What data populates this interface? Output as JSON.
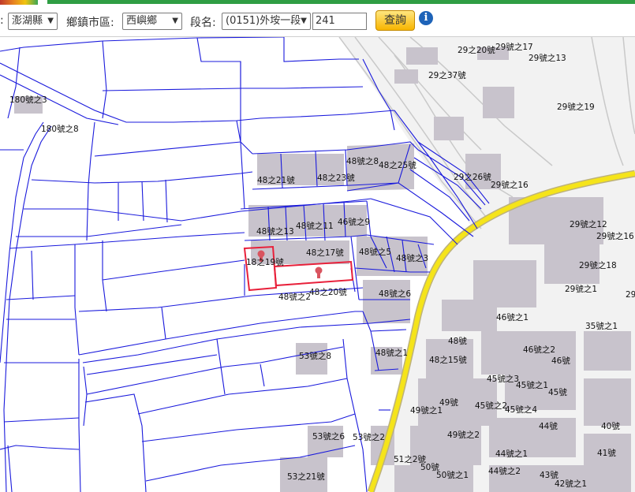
{
  "toolbar": {
    "county": "澎湖縣",
    "township_label": "鄉鎮市區:",
    "township": "西嶼鄉",
    "section_label": "段名:",
    "section": "(0151)外垵一段",
    "parcel_number": "241",
    "query_button": "查詢",
    "info_icon": "i"
  },
  "map": {
    "colors": {
      "parcel_line": "#1a1adc",
      "highlight": "#e8203a",
      "road": "#f5e41a",
      "building": "#c8c3cc",
      "road_outline": "#c9c9c9"
    },
    "labels": [
      "180號之3",
      "180號之8",
      "29之20號",
      "29號之17",
      "29號之13",
      "29之37號",
      "29號之19",
      "48號之8",
      "48之25號",
      "48之21號",
      "48之23號",
      "29之26號",
      "29號之16",
      "48號之13",
      "48號之11",
      "46號之9",
      "29號之12",
      "29號之16",
      "18之19號",
      "48之17號",
      "48號之5",
      "48號之3",
      "29號之18",
      "48號之2",
      "48之20號",
      "48號之6",
      "29號之1",
      "29",
      "46號之1",
      "35號之1",
      "48號",
      "46號之2",
      "46號",
      "48號之1",
      "48之15號",
      "53號之8",
      "45號之3",
      "45號之1",
      "45號",
      "45號之2",
      "45號之4",
      "49號之1",
      "49號",
      "44號",
      "40號",
      "49號之2",
      "53號之6",
      "53號之2",
      "51之2號",
      "50號",
      "44號之1",
      "41號",
      "50號之1",
      "44號之2",
      "43號",
      "53之21號",
      "42號之1"
    ]
  }
}
